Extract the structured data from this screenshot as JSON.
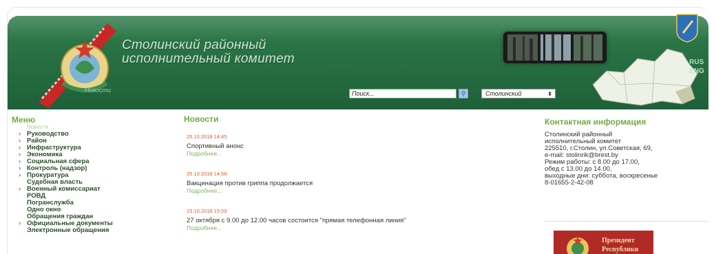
{
  "header": {
    "title_line1": "Столинский районный",
    "title_line2": "исполнительный комитет",
    "nav_link": "Новости",
    "search_placeholder": "Поиск...",
    "district_selected": "Столинский",
    "languages": [
      "RUS",
      "ENG"
    ]
  },
  "menu": {
    "title": "Меню",
    "current": "Новости",
    "items": [
      {
        "label": "Руководство",
        "chevron": true
      },
      {
        "label": "Район",
        "chevron": true
      },
      {
        "label": "Инфраструктура",
        "chevron": true
      },
      {
        "label": "Экономика",
        "chevron": true
      },
      {
        "label": "Социальная сфера",
        "chevron": true
      },
      {
        "label": "Контроль (надзор)",
        "chevron": true
      },
      {
        "label": "Прокуратура",
        "chevron": true
      },
      {
        "label": "Судебная власть",
        "chevron": false
      },
      {
        "label": "Военный комиссариат",
        "chevron": true
      },
      {
        "label": "РОВД",
        "chevron": false
      },
      {
        "label": "Погранслужба",
        "chevron": false
      },
      {
        "label": "Одно окно",
        "chevron": false
      },
      {
        "label": "Обращения граждан",
        "chevron": false
      },
      {
        "label": "Официальные документы",
        "chevron": true
      },
      {
        "label": "Электронные обращения",
        "chevron": false
      }
    ]
  },
  "news": {
    "title": "Новости",
    "more_label": "Подробнее...",
    "entries": [
      {
        "date": "25.10.2018 14:45",
        "text": "Спортивный анонс"
      },
      {
        "date": "25.10.2018 14:58",
        "text": "Вакцинация против гриппа продолжается"
      },
      {
        "date": "23.10.2018 15:09",
        "text": "27 октября с 9.00 до 12.00 часов состоится \"прямая телефонная линия\""
      }
    ]
  },
  "contact": {
    "title": "Контактная информация",
    "lines": [
      "Столинский районный",
      "исполнительный комитет",
      "225510, г.Столин, ул.Советская, 69,",
      "e-mail: stolinrik@brest.by",
      "Режим работы: с 8.00 до 17.00,",
      "обед с 13.00 до 14.00,",
      "выходные дни: суббота, воскресенье",
      "8-01655-2-42-08"
    ]
  },
  "banner": {
    "line1": "Президент",
    "line2": "Республики"
  },
  "colors": {
    "header_green": "#2f7c4b",
    "section_title": "#74a943",
    "news_date": "#e05a2b",
    "banner_red": "#b22a26"
  }
}
